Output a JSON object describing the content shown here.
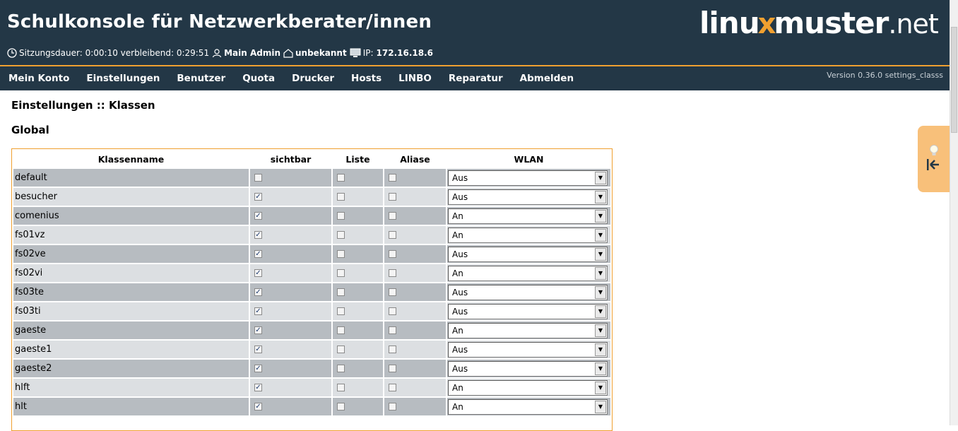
{
  "header": {
    "title": "Schulkonsole für Netzwerkberater/innen",
    "logo": {
      "part1": "linu",
      "x": "x",
      "part2": "muster",
      "part3": ".net"
    },
    "session": {
      "label": "Sitzungsdauer: 0:00:10 verbleibend: 0:29:51",
      "user": "Main Admin",
      "room": "unbekannt",
      "ip_label": "IP:",
      "ip": "172.16.18.6"
    }
  },
  "nav": {
    "items": [
      "Mein Konto",
      "Einstellungen",
      "Benutzer",
      "Quota",
      "Drucker",
      "Hosts",
      "LINBO",
      "Reparatur",
      "Abmelden"
    ],
    "version": "Version 0.36.0 settings_classs"
  },
  "page": {
    "title": "Einstellungen :: Klassen",
    "section": "Global"
  },
  "table": {
    "headers": {
      "name": "Klassenname",
      "visible": "sichtbar",
      "list": "Liste",
      "aliases": "Aliase",
      "wlan": "WLAN"
    },
    "rows": [
      {
        "name": "default",
        "visible": false,
        "list": false,
        "aliases": false,
        "wlan": "Aus"
      },
      {
        "name": "besucher",
        "visible": true,
        "list": false,
        "aliases": false,
        "wlan": "Aus"
      },
      {
        "name": "comenius",
        "visible": true,
        "list": false,
        "aliases": false,
        "wlan": "An"
      },
      {
        "name": "fs01vz",
        "visible": true,
        "list": false,
        "aliases": false,
        "wlan": "An"
      },
      {
        "name": "fs02ve",
        "visible": true,
        "list": false,
        "aliases": false,
        "wlan": "Aus"
      },
      {
        "name": "fs02vi",
        "visible": true,
        "list": false,
        "aliases": false,
        "wlan": "An"
      },
      {
        "name": "fs03te",
        "visible": true,
        "list": false,
        "aliases": false,
        "wlan": "Aus"
      },
      {
        "name": "fs03ti",
        "visible": true,
        "list": false,
        "aliases": false,
        "wlan": "Aus"
      },
      {
        "name": "gaeste",
        "visible": true,
        "list": false,
        "aliases": false,
        "wlan": "An"
      },
      {
        "name": "gaeste1",
        "visible": true,
        "list": false,
        "aliases": false,
        "wlan": "Aus"
      },
      {
        "name": "gaeste2",
        "visible": true,
        "list": false,
        "aliases": false,
        "wlan": "Aus"
      },
      {
        "name": "hlft",
        "visible": true,
        "list": false,
        "aliases": false,
        "wlan": "An"
      },
      {
        "name": "hlt",
        "visible": true,
        "list": false,
        "aliases": false,
        "wlan": "An"
      }
    ]
  },
  "icons": {
    "clock": "clock-icon",
    "user": "user-icon",
    "room": "house-icon",
    "computer": "computer-icon",
    "tip": "lightbulb-icon",
    "collapse": "collapse-arrow-icon"
  },
  "colors": {
    "header_bg": "#233746",
    "accent": "#f0a030",
    "row_odd": "#b7bcc1",
    "row_even": "#dcdfe2",
    "tip_tab": "#f8c07a"
  }
}
